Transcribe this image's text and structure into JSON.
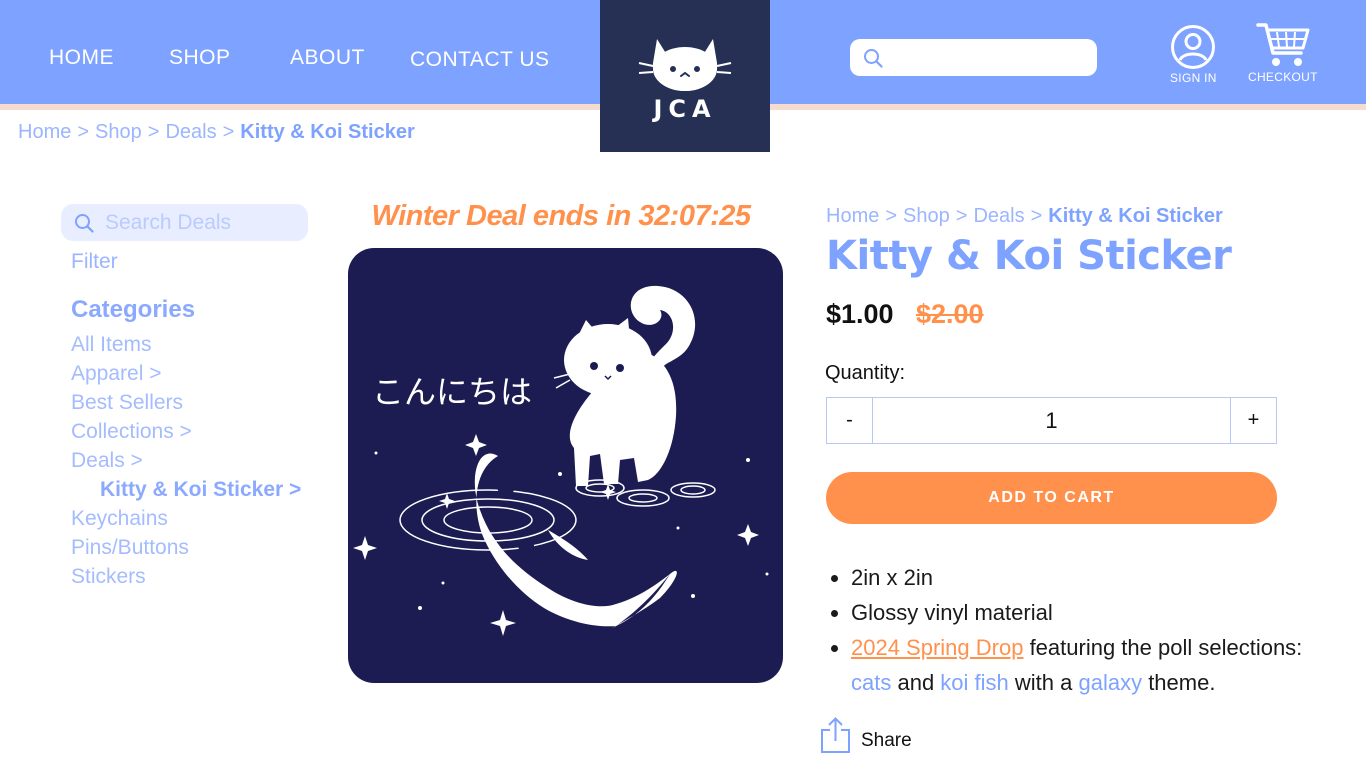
{
  "nav": {
    "home": "HOME",
    "shop": "SHOP",
    "about": "ABOUT",
    "contact": "CONTACT US"
  },
  "logo": {
    "text": "JCA"
  },
  "header": {
    "search_placeholder": "",
    "sign_in": "SIGN IN",
    "checkout": "CHECKOUT"
  },
  "breadcrumb": {
    "items": [
      "Home",
      "Shop",
      "Deals"
    ],
    "current": "Kitty & Koi Sticker",
    "separator": ">"
  },
  "sidebar": {
    "search_placeholder": "Search Deals",
    "filter": "Filter",
    "categories_heading": "Categories",
    "categories": [
      "All Items",
      "Apparel >",
      "Best Sellers",
      "Collections >",
      "Deals >",
      "Kitty & Koi Sticker >",
      "Keychains",
      "Pins/Buttons",
      "Stickers"
    ]
  },
  "deal": {
    "banner": "Winter Deal ends in 32:07:25"
  },
  "product": {
    "image_text": "こんにちは",
    "title": "Kitty & Koi Sticker",
    "price": "$1.00",
    "old_price": "$2.00",
    "quantity_label": "Quantity:",
    "quantity": "1",
    "minus": "-",
    "plus": "+",
    "add_to_cart": "ADD TO CART",
    "details": {
      "size": "2in x 2in",
      "material": "Glossy vinyl material",
      "drop_link": "2024 Spring Drop",
      "drop_text": " featuring the poll selections:",
      "cats": "cats",
      "and": " and ",
      "koi": "koi fish",
      "with": " with a ",
      "galaxy": "galaxy",
      "theme": " theme."
    },
    "share": "Share"
  },
  "colors": {
    "header": "#7ea2ff",
    "logo_bg": "#263055",
    "accent_orange": "#ff914d",
    "accent_blue": "#7ea2ff",
    "image_bg": "#1c1c52"
  },
  "icons": {
    "search": "search-icon",
    "user": "user-circle-icon",
    "cart": "cart-icon",
    "share": "share-icon"
  }
}
